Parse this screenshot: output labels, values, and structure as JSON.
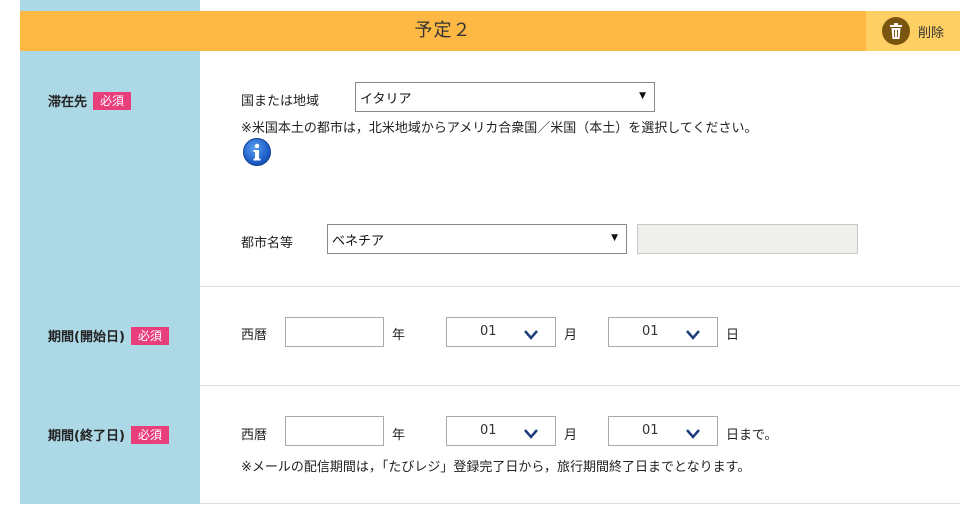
{
  "section": {
    "title": "予定２",
    "delete_label": "削除"
  },
  "colors": {
    "header_bg": "#fdb944",
    "delete_bg": "#fecf62",
    "label_bg": "#add8e6",
    "required_badge": "#e83e7b",
    "info_icon": "#1c5fc9"
  },
  "destination": {
    "label": "滞在先",
    "required": "必須",
    "country_label": "国または地域",
    "country_value": "イタリア",
    "note": "※米国本土の都市は，北米地域からアメリカ合衆国／米国（本土）を選択してください。",
    "info_icon": "info-icon",
    "city_label": "都市名等",
    "city_value": "ベネチア",
    "city_other_value": ""
  },
  "start_period": {
    "label": "期間(開始日)",
    "required": "必須",
    "era_label": "西暦",
    "year_value": "",
    "year_unit": "年",
    "month_value": "01",
    "month_unit": "月",
    "day_value": "01",
    "day_unit": "日"
  },
  "end_period": {
    "label": "期間(終了日)",
    "required": "必須",
    "era_label": "西暦",
    "year_value": "",
    "year_unit": "年",
    "month_value": "01",
    "month_unit": "月",
    "day_value": "01",
    "day_unit": "日まで。",
    "note": "※メールの配信期間は，「たびレジ」登録完了日から，旅行期間終了日までとなります。"
  }
}
